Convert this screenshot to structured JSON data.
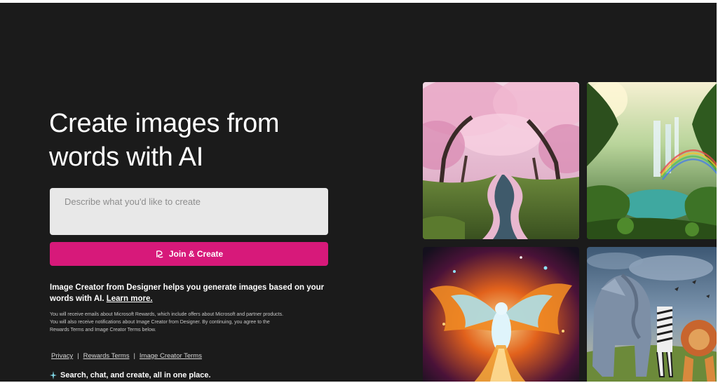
{
  "hero": {
    "title": "Create images from\nwords with AI"
  },
  "prompt": {
    "placeholder": "Describe what you'd like to create",
    "value": ""
  },
  "join_button": {
    "label": "Join & Create",
    "icon": "designer-logo-icon"
  },
  "info": {
    "text": "Image Creator from Designer helps you generate images based on your words with AI.",
    "link_label": "Learn more."
  },
  "legal": {
    "text": "You will receive emails about Microsoft Rewards, which include offers about Microsoft and partner products. You will also receive notifications about Image Creator from Designer. By continuing, you agree to the Rewards Terms and Image Creator Terms below."
  },
  "footer_links": [
    {
      "label": "Privacy"
    },
    {
      "label": "Rewards Terms"
    },
    {
      "label": "Image Creator Terms"
    }
  ],
  "footer_separator": "|",
  "tagline": {
    "text": "Search, chat, and create, all in one place.",
    "icon": "sparkle-icon"
  },
  "gallery": [
    {
      "subject": "cherry blossom path with stream"
    },
    {
      "subject": "jungle waterfall with rainbow"
    },
    {
      "subject": "fiery phoenix"
    },
    {
      "subject": "origami elephant, zebras and lion"
    }
  ],
  "colors": {
    "background": "#1b1b1b",
    "accent": "#d7197a",
    "input_background": "#e8e8e8"
  }
}
